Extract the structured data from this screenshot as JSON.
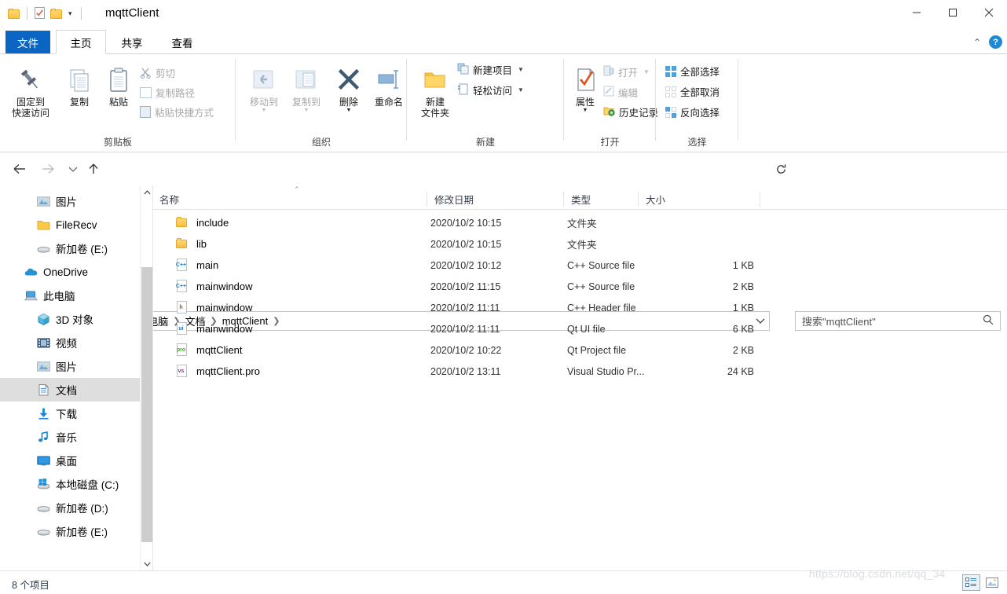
{
  "window": {
    "title": "mqttClient",
    "quick_access": [
      "folder-icon",
      "properties-icon",
      "folder-icon"
    ],
    "controls": {
      "minimize": "minimize-icon",
      "maximize": "maximize-icon",
      "close": "close-icon"
    },
    "ribbon_collapse": "caret-up-icon",
    "help": "?"
  },
  "tabs": [
    {
      "label": "文件",
      "id": "file"
    },
    {
      "label": "主页",
      "id": "home"
    },
    {
      "label": "共享",
      "id": "share"
    },
    {
      "label": "查看",
      "id": "view"
    }
  ],
  "ribbon": {
    "groups": [
      {
        "label": "剪贴板",
        "big": [
          {
            "label1": "固定到",
            "label2": "快速访问",
            "icon": "pin-icon",
            "disabled": false
          },
          {
            "label1": "复制",
            "label2": "",
            "icon": "copy-icon",
            "disabled": false
          },
          {
            "label1": "粘贴",
            "label2": "",
            "icon": "paste-icon",
            "disabled": false
          }
        ],
        "small": [
          {
            "label": "剪切",
            "icon": "scissors-icon",
            "disabled": true
          },
          {
            "label": "复制路径",
            "icon": "copy-path-icon",
            "disabled": true
          },
          {
            "label": "粘贴快捷方式",
            "icon": "paste-shortcut-icon",
            "disabled": true
          }
        ]
      },
      {
        "label": "组织",
        "big": [
          {
            "label1": "移动到",
            "label2": "",
            "icon": "move-to-icon",
            "disabled": true,
            "menu": true
          },
          {
            "label1": "复制到",
            "label2": "",
            "icon": "copy-to-icon",
            "disabled": true,
            "menu": true
          },
          {
            "label1": "删除",
            "label2": "",
            "icon": "delete-icon",
            "disabled": false,
            "menu": true
          },
          {
            "label1": "重命名",
            "label2": "",
            "icon": "rename-icon",
            "disabled": false
          }
        ],
        "small": []
      },
      {
        "label": "新建",
        "big": [
          {
            "label1": "新建",
            "label2": "文件夹",
            "icon": "new-folder-icon",
            "disabled": false
          }
        ],
        "small": [
          {
            "label": "新建项目",
            "icon": "new-item-icon",
            "disabled": false,
            "menu": true
          },
          {
            "label": "轻松访问",
            "icon": "easy-access-icon",
            "disabled": false,
            "menu": true
          }
        ]
      },
      {
        "label": "打开",
        "big": [
          {
            "label1": "属性",
            "label2": "",
            "icon": "properties-icon",
            "disabled": false,
            "menu": true
          }
        ],
        "small": [
          {
            "label": "打开",
            "icon": "open-icon",
            "disabled": true,
            "menu": true
          },
          {
            "label": "编辑",
            "icon": "edit-icon",
            "disabled": true
          },
          {
            "label": "历史记录",
            "icon": "history-icon",
            "disabled": false
          }
        ]
      },
      {
        "label": "选择",
        "big": [],
        "small": [
          {
            "label": "全部选择",
            "icon": "select-all-icon",
            "disabled": false
          },
          {
            "label": "全部取消",
            "icon": "select-none-icon",
            "disabled": false
          },
          {
            "label": "反向选择",
            "icon": "invert-selection-icon",
            "disabled": false
          }
        ]
      }
    ]
  },
  "nav": {
    "back": "back-arrow-icon",
    "forward": "forward-arrow-icon",
    "recent": "chevron-down-icon",
    "up": "up-arrow-icon",
    "refresh": "refresh-icon",
    "dropdown": "chevron-down-icon",
    "breadcrumb": [
      "此电脑",
      "文档",
      "mqttClient"
    ],
    "search_placeholder": "搜索\"mqttClient\"",
    "search_value": "",
    "search_icon": "search-icon"
  },
  "sidebar": {
    "items": [
      {
        "label": "图片",
        "icon": "pictures-icon",
        "indent": 1,
        "selected": false,
        "pinned": true
      },
      {
        "label": "FileRecv",
        "icon": "folder-icon",
        "indent": 1,
        "selected": false
      },
      {
        "label": "新加卷 (E:)",
        "icon": "drive-icon",
        "indent": 1,
        "selected": false
      },
      {
        "label": "OneDrive",
        "icon": "onedrive-icon",
        "indent": 0,
        "selected": false
      },
      {
        "label": "此电脑",
        "icon": "this-pc-icon",
        "indent": 0,
        "selected": false
      },
      {
        "label": "3D 对象",
        "icon": "3d-objects-icon",
        "indent": 1,
        "selected": false
      },
      {
        "label": "视频",
        "icon": "videos-icon",
        "indent": 1,
        "selected": false
      },
      {
        "label": "图片",
        "icon": "pictures-icon",
        "indent": 1,
        "selected": false
      },
      {
        "label": "文档",
        "icon": "documents-icon",
        "indent": 1,
        "selected": true
      },
      {
        "label": "下载",
        "icon": "downloads-icon",
        "indent": 1,
        "selected": false
      },
      {
        "label": "音乐",
        "icon": "music-icon",
        "indent": 1,
        "selected": false
      },
      {
        "label": "桌面",
        "icon": "desktop-icon",
        "indent": 1,
        "selected": false
      },
      {
        "label": "本地磁盘 (C:)",
        "icon": "windows-drive-icon",
        "indent": 1,
        "selected": false
      },
      {
        "label": "新加卷 (D:)",
        "icon": "drive-icon",
        "indent": 1,
        "selected": false
      },
      {
        "label": "新加卷 (E:)",
        "icon": "drive-icon",
        "indent": 1,
        "selected": false
      }
    ],
    "scroll_up": "scroll-up-icon",
    "scroll_down": "scroll-down-icon"
  },
  "filelist": {
    "columns": [
      {
        "label": "名称",
        "sorted": true
      },
      {
        "label": "修改日期",
        "sorted": false
      },
      {
        "label": "类型",
        "sorted": false
      },
      {
        "label": "大小",
        "sorted": false
      }
    ],
    "sort_indicator": "▲",
    "rows": [
      {
        "name": "include",
        "date": "2020/10/2 10:15",
        "type": "文件夹",
        "size": "",
        "icon": "folder-icon",
        "tag": "",
        "tagcolor": ""
      },
      {
        "name": "lib",
        "date": "2020/10/2 10:15",
        "type": "文件夹",
        "size": "",
        "icon": "folder-icon",
        "tag": "",
        "tagcolor": ""
      },
      {
        "name": "main",
        "date": "2020/10/2 10:12",
        "type": "C++ Source file",
        "size": "1 KB",
        "icon": "cpp-file-icon",
        "tag": "C++",
        "tagcolor": "#1a84c7"
      },
      {
        "name": "mainwindow",
        "date": "2020/10/2 11:15",
        "type": "C++ Source file",
        "size": "2 KB",
        "icon": "cpp-file-icon",
        "tag": "C++",
        "tagcolor": "#1a84c7"
      },
      {
        "name": "mainwindow",
        "date": "2020/10/2 11:11",
        "type": "C++ Header file",
        "size": "1 KB",
        "icon": "h-file-icon",
        "tag": "h",
        "tagcolor": "#c0392b"
      },
      {
        "name": "mainwindow",
        "date": "2020/10/2 11:11",
        "type": "Qt UI file",
        "size": "6 KB",
        "icon": "ui-file-icon",
        "tag": "ui",
        "tagcolor": "#2f6fb5"
      },
      {
        "name": "mqttClient",
        "date": "2020/10/2 10:22",
        "type": "Qt Project file",
        "size": "2 KB",
        "icon": "pro-file-icon",
        "tag": "pro",
        "tagcolor": "#44a833"
      },
      {
        "name": "mqttClient.pro",
        "date": "2020/10/2 13:11",
        "type": "Visual Studio Pr...",
        "size": "24 KB",
        "icon": "vs-file-icon",
        "tag": "vs",
        "tagcolor": "#8b2fa0"
      }
    ]
  },
  "status": {
    "item_count": "8 个项目",
    "views": [
      {
        "icon": "details-view-icon",
        "active": true
      },
      {
        "icon": "large-icons-view-icon",
        "active": false
      }
    ],
    "watermark": "https://blog.csdn.net/qq_34"
  }
}
